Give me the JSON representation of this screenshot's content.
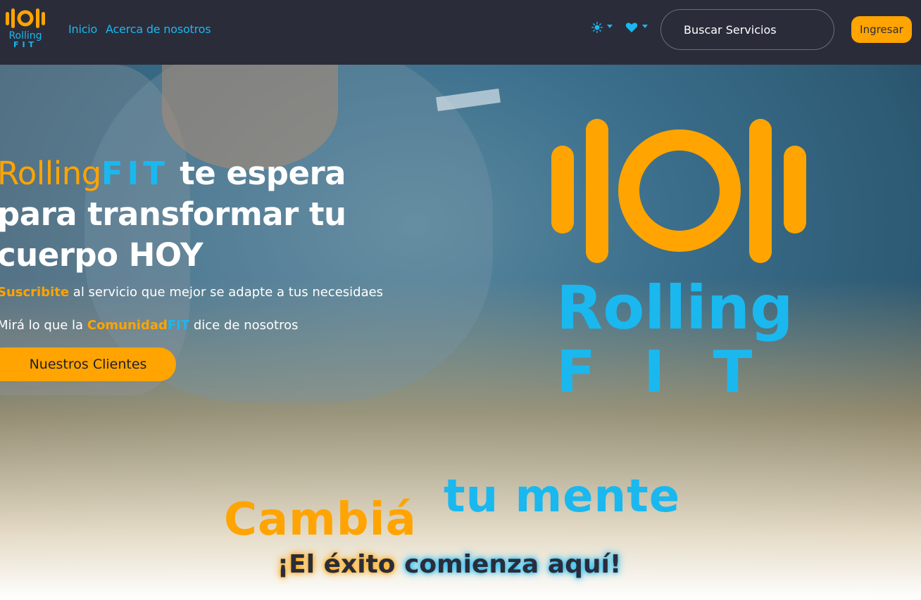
{
  "nav": {
    "brand_alt": "RollingFIT",
    "links": [
      "Inicio",
      "Acerca de nosotros"
    ],
    "theme_icon": "sun-icon",
    "favorites_icon": "heart-icon",
    "search_placeholder": "Buscar Servicios",
    "login_label": "Ingresar"
  },
  "hero": {
    "headline_rolling": "Rolling",
    "headline_fit": "FIT",
    "headline_rest": " te espera para transformar tu cuerpo HOY",
    "sub1_accent": "Suscribite",
    "sub1_rest": " al servicio que mejor se adapte a tus necesidaes",
    "sub2_start": "Mirá lo que la ",
    "sub2_accent_orange": "Comunidad",
    "sub2_accent_blue": "FIT",
    "sub2_end": " dice de nosotros",
    "clients_button": "Nuestros Clientes",
    "logo_word1": "Rolling",
    "logo_word2": "FIT",
    "cambia": "Cambiá",
    "tu_mente": "tu mente",
    "exito_part1": "¡El éxito",
    "exito_part2": " comienza aquí!"
  },
  "colors": {
    "nav_bg": "#2b2c3a",
    "brand_orange": "#ffa400",
    "brand_blue": "#1ab8ef"
  }
}
